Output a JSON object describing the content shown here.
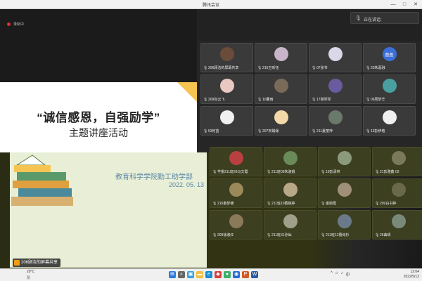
{
  "window": {
    "title": "腾讯会议",
    "min": "—",
    "max": "□",
    "close": "✕"
  },
  "recording": {
    "label": "录制中"
  },
  "speaking": {
    "label": "正在讲话:"
  },
  "slide": {
    "title": "“诚信感恩，自强励学”",
    "subtitle": "主题讲座活动",
    "org": "教育科学学院勤工助学部",
    "date": "2022. 05. 13"
  },
  "participants_top": [
    {
      "name": "206顾洁的屏幕共享",
      "color": "#6b4c3a"
    },
    {
      "name": "216王昕钰",
      "color": "#c9b5c9"
    },
    {
      "name": "07张书",
      "color": "#d8d8e8"
    },
    {
      "name": "20朱嘉融",
      "color": "#3b6fd9",
      "initials": "盈盈"
    },
    {
      "name": "209肖云飞",
      "color": "#e8c8c0"
    },
    {
      "name": "10董雨",
      "color": "#7a6a5a"
    },
    {
      "name": "17谢琴琴",
      "color": "#6a5aa0"
    },
    {
      "name": "06周梦华",
      "color": "#4aa0a0"
    },
    {
      "name": "53何苗",
      "color": "#f0f0f0"
    },
    {
      "name": "207宋娟缘",
      "color": "#f3d8a8"
    },
    {
      "name": "211夏丽萍",
      "color": "#6a7a6a"
    },
    {
      "name": "13彭伊格",
      "color": "#f0f0f0"
    }
  ],
  "participants_bottom": [
    {
      "name": "学委211班26马文霞",
      "color": "#b84040"
    },
    {
      "name": "211班09朱淑娟",
      "color": "#6a8a5a"
    },
    {
      "name": "19彭清林",
      "color": "#8a9a7a"
    },
    {
      "name": "21彭雅鑫 02",
      "color": "#7a7a5a"
    },
    {
      "name": "216秦梦楠",
      "color": "#9a8a5a"
    },
    {
      "name": "211班10蔡婉婷",
      "color": "#b8a888"
    },
    {
      "name": "谢丽霞",
      "color": "#a0907a"
    },
    {
      "name": "209白书婷",
      "color": "#6a6a4a"
    },
    {
      "name": "209徐淑红",
      "color": "#8a7a5a"
    },
    {
      "name": "211班31孙灿",
      "color": "#a0a08a"
    },
    {
      "name": "211班12曹烁杉",
      "color": "#6a7a8a"
    },
    {
      "name": "25曲晴",
      "color": "#7a8a7a"
    }
  ],
  "sharing": {
    "label": "206顾洁的屏幕共享"
  },
  "taskbar": {
    "weather_temp": "29°C",
    "weather_desc": "阴",
    "tray_lang": "中",
    "time": "12:04",
    "date": "2022/5/13"
  },
  "colors": {
    "accent": "#3b6fd9",
    "record": "#e03030",
    "slide_corner": "#f5c451",
    "slide_text": "#5a87a8"
  }
}
